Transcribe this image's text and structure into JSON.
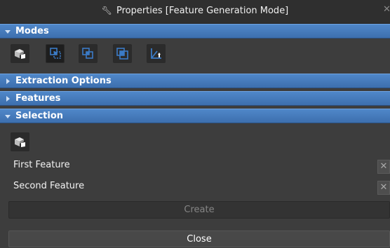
{
  "window": {
    "title": "Properties [Feature Generation Mode]",
    "close_glyph": "✕"
  },
  "sections": {
    "modes": {
      "label": "Modes"
    },
    "extraction": {
      "label": "Extraction Options"
    },
    "features": {
      "label": "Features"
    },
    "selection": {
      "label": "Selection"
    }
  },
  "modes_toolbar": {
    "icons": [
      "solid-select-icon",
      "face-select-icon",
      "edge-pair-icon",
      "overlap-icon",
      "axis-icon"
    ]
  },
  "selection_panel": {
    "first_feature_label": "First Feature",
    "second_feature_label": "Second Feature",
    "clear_glyph": "✕"
  },
  "buttons": {
    "create": "Create",
    "close": "Close"
  },
  "colors": {
    "section_header": "#4a80c0",
    "panel_bg": "#3d3d3d",
    "icon_accent": "#3b7bc6"
  }
}
